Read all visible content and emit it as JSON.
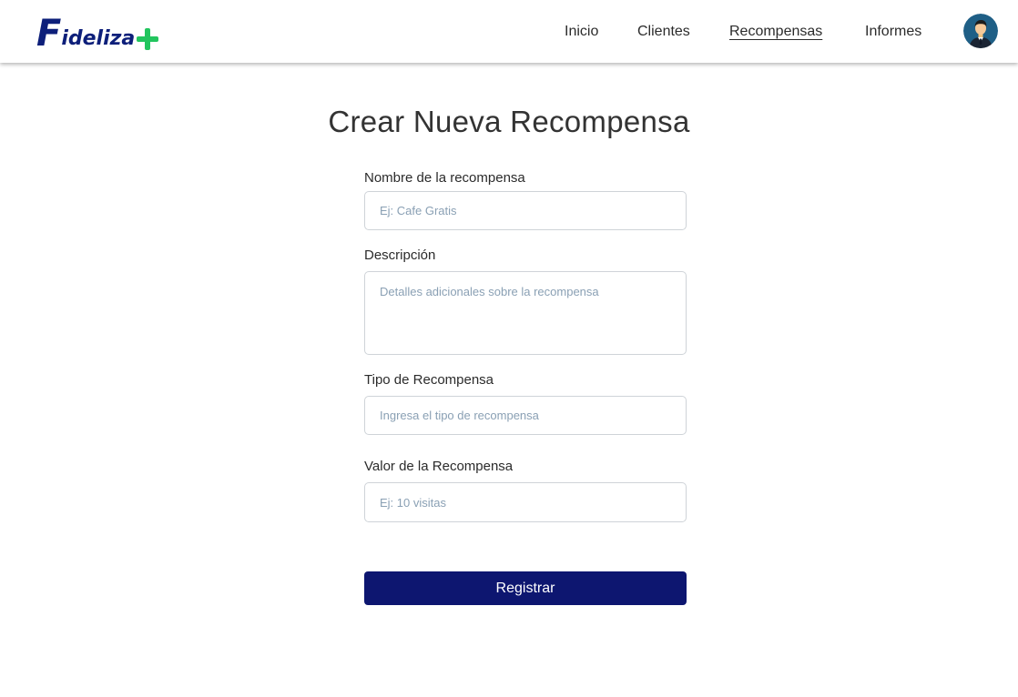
{
  "brand": {
    "logo_first": "F",
    "logo_rest": "ideliza",
    "logo_accent": "#22c55e",
    "logo_color": "#0d1f7a"
  },
  "nav": {
    "items": [
      {
        "label": "Inicio",
        "active": false
      },
      {
        "label": "Clientes",
        "active": false
      },
      {
        "label": "Recompensas",
        "active": true
      },
      {
        "label": "Informes",
        "active": false
      }
    ],
    "avatar_icon": "user-avatar"
  },
  "page": {
    "title": "Crear Nueva Recompensa"
  },
  "form": {
    "name": {
      "label": "Nombre de la recompensa",
      "value": "",
      "placeholder": "Ej: Cafe Gratis"
    },
    "description": {
      "label": "Descripción",
      "value": "",
      "placeholder": "Detalles adicionales sobre la recompensa"
    },
    "type": {
      "label": "Tipo de Recompensa",
      "value": "",
      "placeholder": "Ingresa el tipo de recompensa"
    },
    "value": {
      "label": "Valor de la Recompensa",
      "value": "",
      "placeholder": "Ej: 10 visitas"
    },
    "submit_label": "Registrar"
  },
  "colors": {
    "primary_button": "#0d1670",
    "input_border": "#cfd3d8",
    "placeholder": "#8aa0b4"
  }
}
